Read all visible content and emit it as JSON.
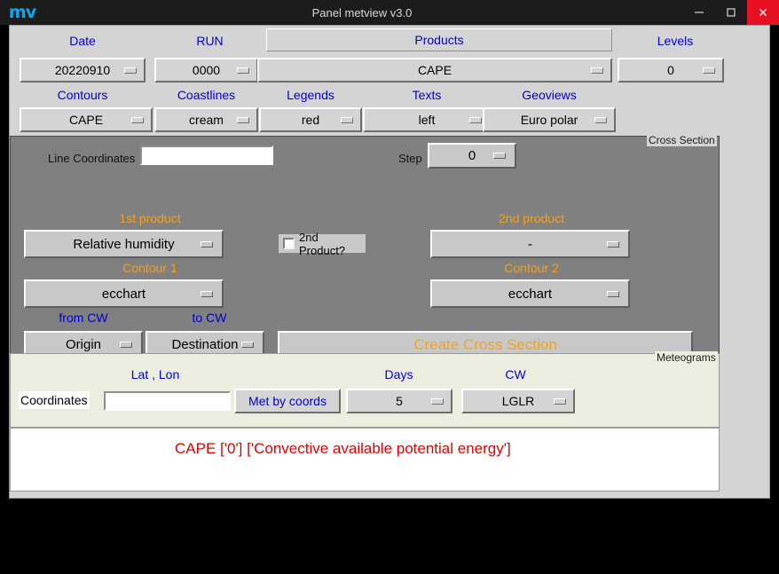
{
  "window": {
    "title": "Panel metview v3.0",
    "icon": "mv",
    "minimize": "minimize-icon",
    "maximize": "maximize-icon",
    "close": "close-icon"
  },
  "top": {
    "labels": {
      "date": "Date",
      "run": "RUN",
      "products": "Products",
      "levels": "Levels",
      "contours": "Contours",
      "coastlines": "Coastlines",
      "legends": "Legends",
      "texts": "Texts",
      "geoviews": "Geoviews"
    },
    "values": {
      "date": "20220910",
      "run": "0000",
      "products": "CAPE",
      "levels": "0",
      "contours": "CAPE",
      "coastlines": "cream",
      "legends": "red",
      "texts": "left",
      "geoviews": "Euro polar"
    }
  },
  "cross_section": {
    "legend": "Cross Section",
    "line_coordinates_label": "Line Coordinates",
    "line_coordinates_value": "",
    "line_coordinates_placeholder": "",
    "step_label": "Step",
    "step_value": "0",
    "first_product_label": "1st product",
    "first_product_value": "Relative humidity",
    "second_product_checkbox_label": "2nd Product?",
    "second_product_checked": false,
    "second_product_label": "2nd product",
    "second_product_value": "-",
    "contour1_label": "Contour 1",
    "contour1_value": "ecchart",
    "contour2_label": "Contour 2",
    "contour2_value": "ecchart",
    "from_cw_label": "from CW",
    "to_cw_label": "to CW",
    "origin_value": "Origin",
    "destination_value": "Destination",
    "create_button": "Create Cross Section"
  },
  "meteograms": {
    "legend": "Meteograms",
    "latlon_label": "Lat , Lon",
    "days_label": "Days",
    "cw_label": "CW",
    "coordinates_label": "Coordinates",
    "coordinates_value": "",
    "coordinates_placeholder": "",
    "met_by_coords_button": "Met by coords",
    "days_value": "5",
    "cw_value": "LGLR"
  },
  "message": {
    "text": "CAPE   ['0']   ['Convective available potential energy']"
  },
  "colors": {
    "label_blue": "#0000d0",
    "accent_orange": "#f5a01e",
    "message_red": "#e00000",
    "panel_gray": "#808080",
    "meteo_bg": "#eceddf",
    "app_bg": "#d4d4d4",
    "close_red": "#e81123",
    "icon_cyan": "#0aa8f0"
  }
}
